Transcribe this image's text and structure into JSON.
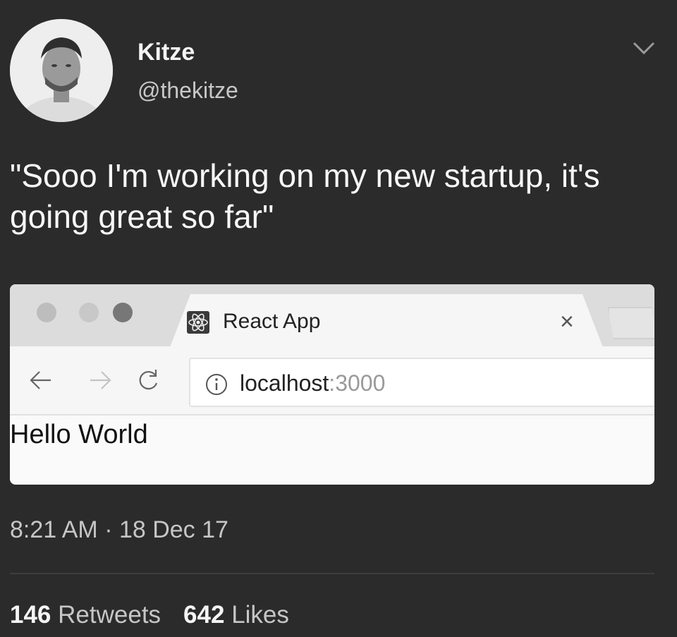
{
  "author": {
    "display_name": "Kitze",
    "handle": "@thekitze"
  },
  "tweet": {
    "text": "\"Sooo I'm working on my new startup, it's going great so far\""
  },
  "browser": {
    "tab_title": "React App",
    "tab_close": "×",
    "url_host": "localhost",
    "url_port": ":3000",
    "page_text": "Hello World"
  },
  "meta": {
    "timestamp": "8:21 AM · 18 Dec 17"
  },
  "stats": {
    "retweets_count": "146",
    "retweets_label": "Retweets",
    "likes_count": "642",
    "likes_label": "Likes"
  },
  "icons": {
    "caret": "chevron-down-icon",
    "tab_favicon": "react-atom-icon",
    "back": "arrow-left-icon",
    "forward": "arrow-right-icon",
    "reload": "reload-icon",
    "info": "info-icon"
  }
}
